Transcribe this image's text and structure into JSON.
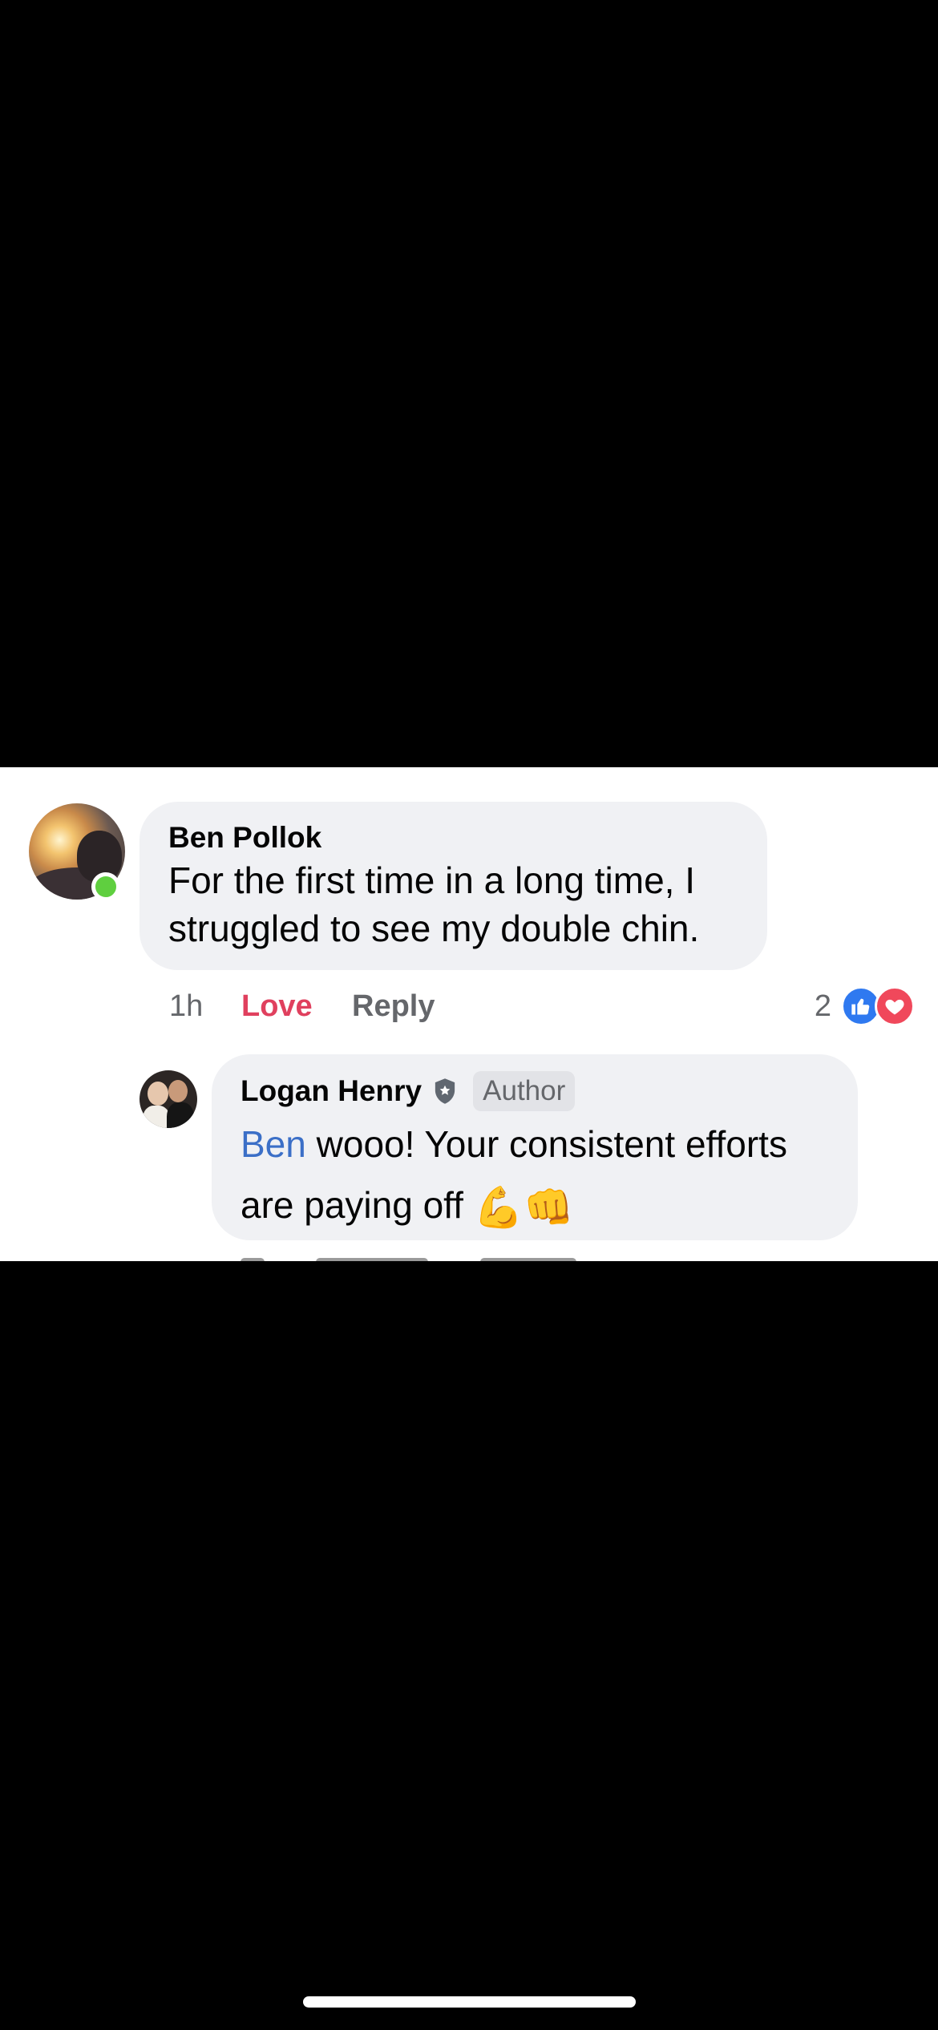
{
  "comments": [
    {
      "author": "Ben Pollok",
      "text": "For the first time in a long time, I struggled to see my double chin.",
      "online": true,
      "meta": {
        "time": "1h",
        "reaction_label": "Love",
        "reply_label": "Reply",
        "reaction_count": "2",
        "reactions": [
          "like-icon",
          "heart-icon"
        ]
      }
    }
  ],
  "reply": {
    "author": "Logan Henry",
    "badge": "Author",
    "mention": "Ben",
    "text": " wooo! Your consistent efforts are paying off ",
    "emojis": "💪👊"
  },
  "colors": {
    "bubble": "#f0f1f4",
    "mention": "#3b6fc7",
    "love": "#e0405e",
    "online": "#5fcf3f",
    "like": "#2f79f0",
    "heart": "#f0485b"
  }
}
